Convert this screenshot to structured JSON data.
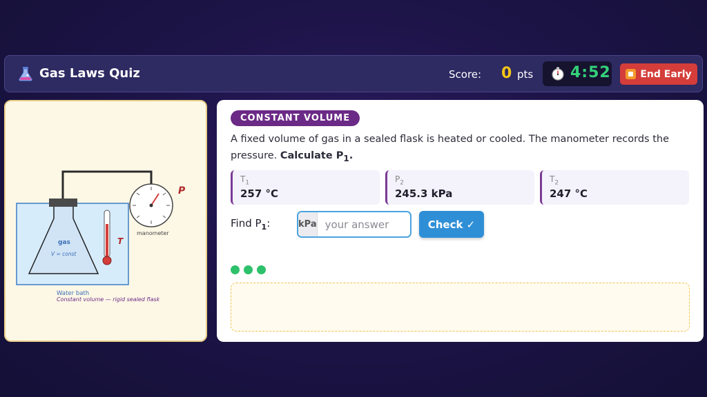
{
  "header": {
    "app_icon": "flask-icon",
    "title": "Gas Laws Quiz",
    "score_label": "Score:",
    "score_value": "0",
    "score_unit": "pts",
    "timer_icon": "stopwatch-icon",
    "timer": "4:52",
    "end_button": "End Early"
  },
  "diagram": {
    "pressure_label": "P",
    "temperature_label": "T",
    "gauge_label": "manometer",
    "gas_label": "gas",
    "volume_label": "V = const",
    "bath_label": "Water bath",
    "caption": "Constant volume — rigid sealed flask"
  },
  "question": {
    "tag": "CONSTANT VOLUME",
    "text": "A fixed volume of gas in a sealed flask is heated or cooled. The manometer records the pressure.",
    "prompt": "Calculate P",
    "prompt_sub": "1",
    "prompt_end": ".",
    "given": [
      {
        "symbol": "T",
        "sub": "1",
        "value": "257 °C"
      },
      {
        "symbol": "P",
        "sub": "2",
        "value": "245.3 kPa"
      },
      {
        "symbol": "T",
        "sub": "2",
        "value": "247 °C"
      }
    ],
    "find_label": "Find P",
    "find_sub": "1",
    "find_colon": ":",
    "unit": "kPa",
    "answer_placeholder": "your answer",
    "answer_value": "",
    "check_button": "Check ✓"
  },
  "progress_dots": 3,
  "colors": {
    "accent_purple": "#6b2a86",
    "timer_green": "#34d17a",
    "score_gold": "#f5c518",
    "end_red": "#d43d3a",
    "check_blue": "#2f8fd6",
    "dot_green": "#2ec16b"
  }
}
